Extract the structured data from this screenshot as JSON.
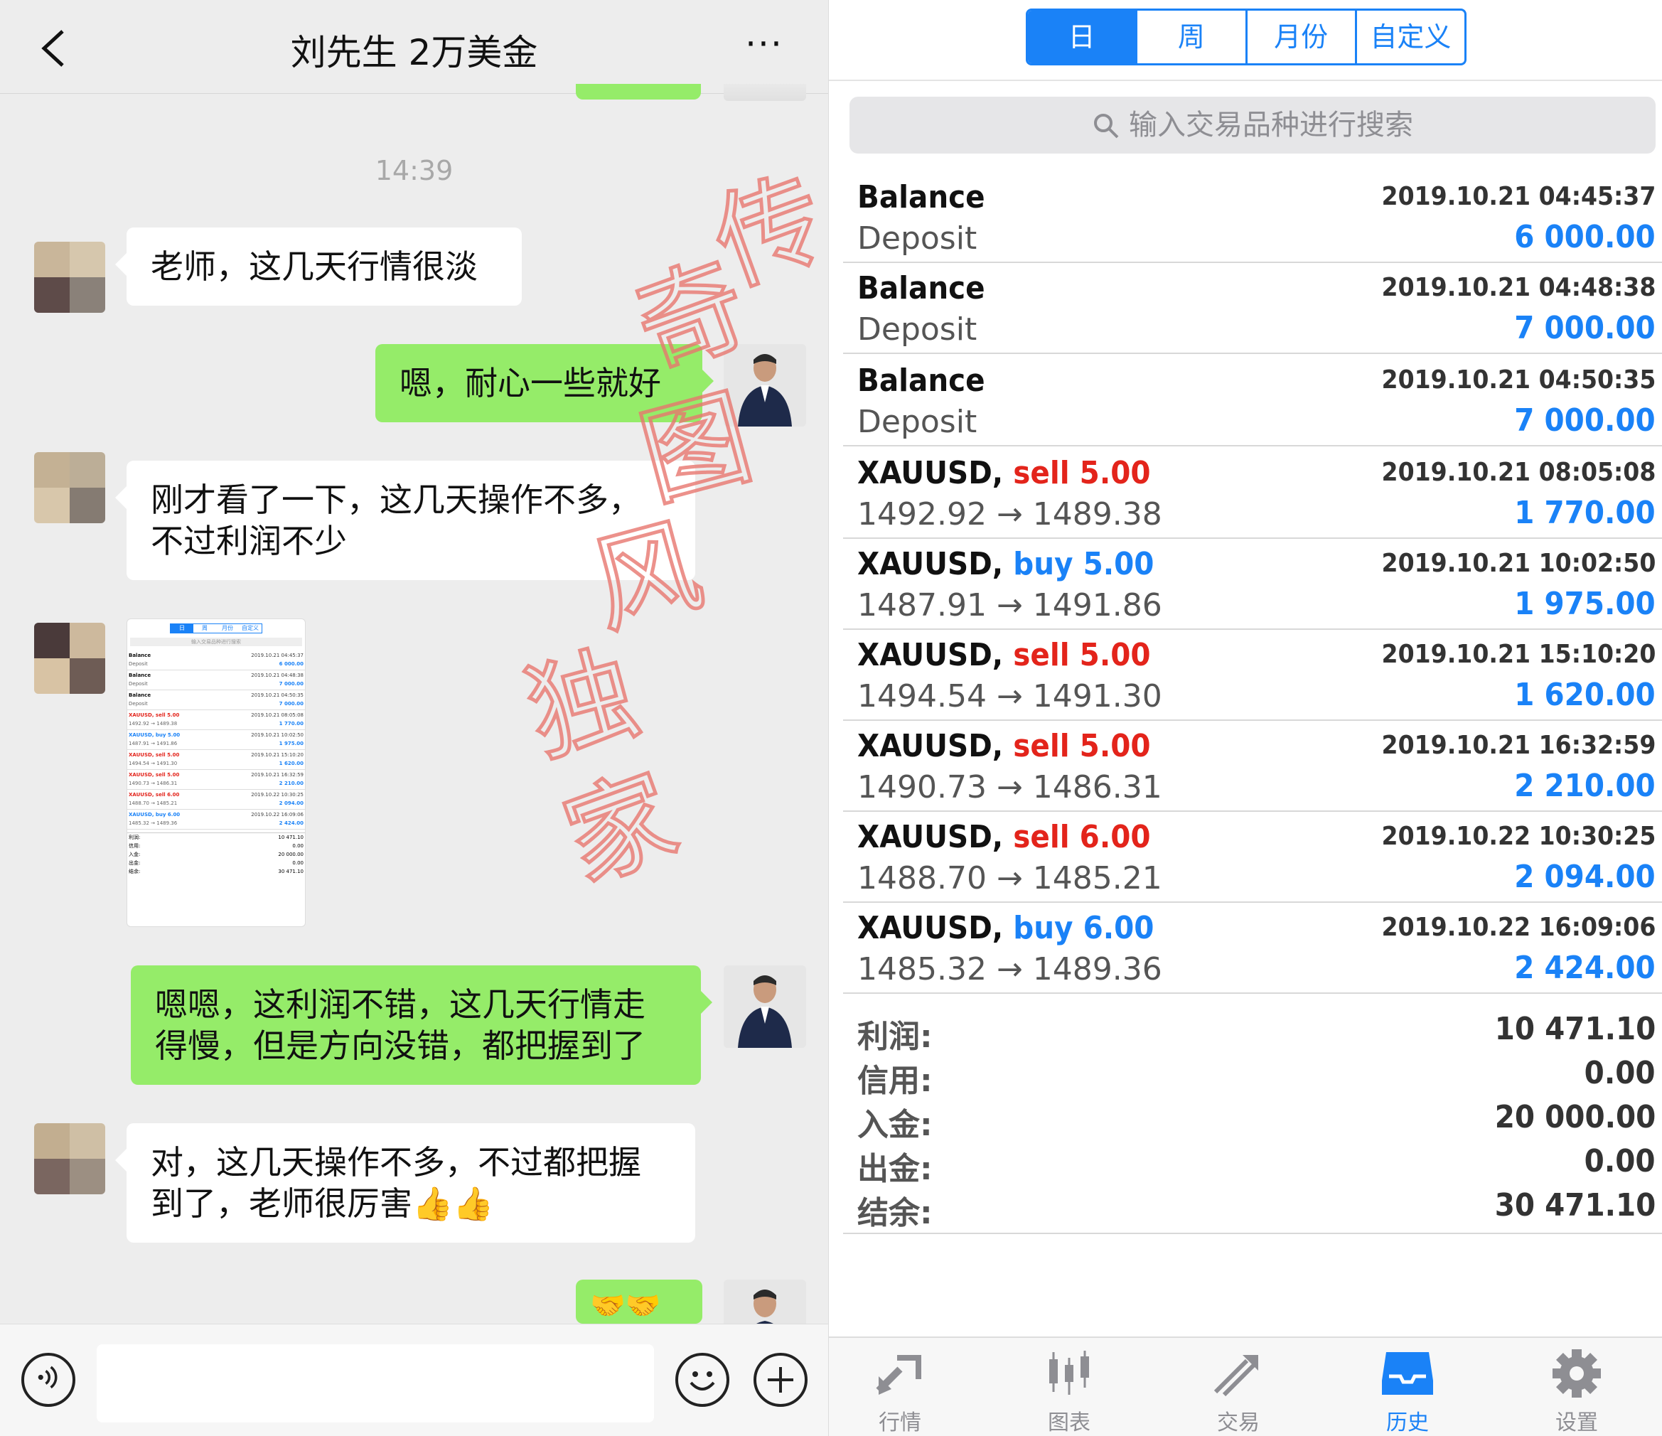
{
  "chat": {
    "title": "刘先生 2万美金",
    "more": "···",
    "timestamp": "14:39",
    "messages": [
      {
        "side": "left",
        "text": "老师，这几天行情很淡"
      },
      {
        "side": "right",
        "text": "嗯，耐心一些就好"
      },
      {
        "side": "left",
        "text": "刚才看了一下，这几天操作不多，不过利润不少"
      },
      {
        "side": "left",
        "text": "[image]"
      },
      {
        "side": "right",
        "text": "嗯嗯，这利润不错，这几天行情走得慢，但是方向没错，都把握到了"
      },
      {
        "side": "left",
        "text": "对，这几天操作不多，不过都把握到了，老师很厉害👍👍"
      },
      {
        "side": "right",
        "text": "🤝🤝"
      }
    ],
    "input_placeholder": ""
  },
  "thumbnail": {
    "tabs": [
      "日",
      "周",
      "月份",
      "自定义"
    ],
    "search": "输入交易品种进行搜索",
    "rows": [
      {
        "a": "Balance",
        "b": "2019.10.21 04:45:37",
        "c": "Deposit",
        "d": "6 000.00"
      },
      {
        "a": "Balance",
        "b": "2019.10.21 04:48:38",
        "c": "Deposit",
        "d": "7 000.00"
      },
      {
        "a": "Balance",
        "b": "2019.10.21 04:50:35",
        "c": "Deposit",
        "d": "7 000.00"
      },
      {
        "a": "XAUUSD, sell 5.00",
        "b": "2019.10.21 08:05:08",
        "c": "1492.92 → 1489.38",
        "d": "1 770.00"
      },
      {
        "a": "XAUUSD, buy 5.00",
        "b": "2019.10.21 10:02:50",
        "c": "1487.91 → 1491.86",
        "d": "1 975.00"
      },
      {
        "a": "XAUUSD, sell 5.00",
        "b": "2019.10.21 15:10:20",
        "c": "1494.54 → 1491.30",
        "d": "1 620.00"
      },
      {
        "a": "XAUUSD, sell 5.00",
        "b": "2019.10.21 16:32:59",
        "c": "1490.73 → 1486.31",
        "d": "2 210.00"
      },
      {
        "a": "XAUUSD, sell 6.00",
        "b": "2019.10.22 10:30:25",
        "c": "1488.70 → 1485.21",
        "d": "2 094.00"
      },
      {
        "a": "XAUUSD, buy 6.00",
        "b": "2019.10.22 16:09:06",
        "c": "1485.32 → 1489.36",
        "d": "2 424.00"
      }
    ],
    "summary": [
      {
        "k": "利润:",
        "v": "10 471.10"
      },
      {
        "k": "信用:",
        "v": "0.00"
      },
      {
        "k": "入金:",
        "v": "20 000.00"
      },
      {
        "k": "出金:",
        "v": "0.00"
      },
      {
        "k": "结余:",
        "v": "30 471.10"
      }
    ]
  },
  "mt": {
    "periods": [
      "日",
      "周",
      "月份",
      "自定义"
    ],
    "search_placeholder": "输入交易品种进行搜索",
    "deals": [
      {
        "symbol": "Balance",
        "side": "",
        "volume": "",
        "time": "2019.10.21 04:45:37",
        "detail": "Deposit",
        "profit": "6 000.00"
      },
      {
        "symbol": "Balance",
        "side": "",
        "volume": "",
        "time": "2019.10.21 04:48:38",
        "detail": "Deposit",
        "profit": "7 000.00"
      },
      {
        "symbol": "Balance",
        "side": "",
        "volume": "",
        "time": "2019.10.21 04:50:35",
        "detail": "Deposit",
        "profit": "7 000.00"
      },
      {
        "symbol": "XAUUSD,",
        "side": "sell",
        "volume": "5.00",
        "time": "2019.10.21 08:05:08",
        "detail": "1492.92 → 1489.38",
        "profit": "1 770.00"
      },
      {
        "symbol": "XAUUSD,",
        "side": "buy",
        "volume": "5.00",
        "time": "2019.10.21 10:02:50",
        "detail": "1487.91 → 1491.86",
        "profit": "1 975.00"
      },
      {
        "symbol": "XAUUSD,",
        "side": "sell",
        "volume": "5.00",
        "time": "2019.10.21 15:10:20",
        "detail": "1494.54 → 1491.30",
        "profit": "1 620.00"
      },
      {
        "symbol": "XAUUSD,",
        "side": "sell",
        "volume": "5.00",
        "time": "2019.10.21 16:32:59",
        "detail": "1490.73 → 1486.31",
        "profit": "2 210.00"
      },
      {
        "symbol": "XAUUSD,",
        "side": "sell",
        "volume": "6.00",
        "time": "2019.10.22 10:30:25",
        "detail": "1488.70 → 1485.21",
        "profit": "2 094.00"
      },
      {
        "symbol": "XAUUSD,",
        "side": "buy",
        "volume": "6.00",
        "time": "2019.10.22 16:09:06",
        "detail": "1485.32 → 1489.36",
        "profit": "2 424.00"
      }
    ],
    "summary": [
      {
        "label": "利润:",
        "value": "10 471.10"
      },
      {
        "label": "信用:",
        "value": "0.00"
      },
      {
        "label": "入金:",
        "value": "20 000.00"
      },
      {
        "label": "出金:",
        "value": "0.00"
      },
      {
        "label": "结余:",
        "value": "30 471.10"
      }
    ],
    "tabs": [
      {
        "label": "行情",
        "icon": "quotes-icon"
      },
      {
        "label": "图表",
        "icon": "chart-icon"
      },
      {
        "label": "交易",
        "icon": "trade-icon"
      },
      {
        "label": "历史",
        "icon": "history-icon"
      },
      {
        "label": "设置",
        "icon": "settings-icon"
      }
    ],
    "active_tab": "历史"
  },
  "watermark": {
    "chars": [
      "传",
      "奇",
      "图",
      "风",
      "独",
      "家"
    ],
    "color": "#e8766e"
  },
  "colors": {
    "wechat_green": "#95ec69",
    "mt_blue": "#1a82f7",
    "sell_red": "#e3241b"
  }
}
